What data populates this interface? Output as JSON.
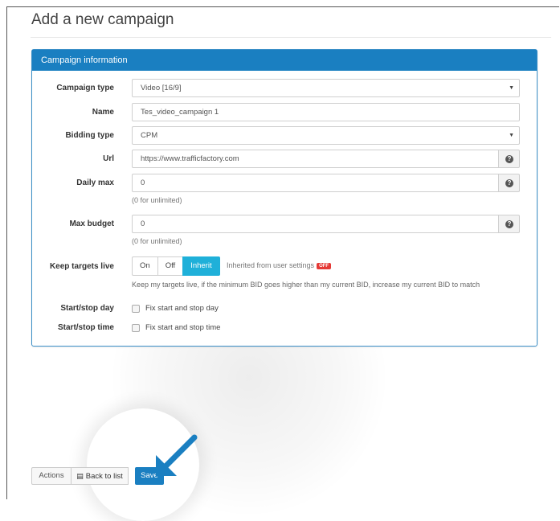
{
  "page": {
    "title": "Add a new campaign"
  },
  "panel": {
    "header": "Campaign information",
    "fields": {
      "campaign_type": {
        "label": "Campaign type",
        "value": "Video [16/9]"
      },
      "name": {
        "label": "Name",
        "value": "Tes_video_campaign 1"
      },
      "bidding_type": {
        "label": "Bidding type",
        "value": "CPM"
      },
      "url": {
        "label": "Url",
        "value": "https://www.trafficfactory.com"
      },
      "daily_max": {
        "label": "Daily max",
        "value": "0",
        "hint": "(0 for unlimited)"
      },
      "max_budget": {
        "label": "Max budget",
        "value": "0",
        "hint": "(0 for unlimited)"
      },
      "keep_targets_live": {
        "label": "Keep targets live",
        "options": [
          "On",
          "Off",
          "Inherit"
        ],
        "selected": "Inherit",
        "inherited_note": "Inherited from user settings",
        "badge": "OFF",
        "description": "Keep my targets live, if the minimum BID goes higher than my current BID, increase my current BID to match"
      },
      "start_stop_day": {
        "label": "Start/stop day",
        "checkbox_label": "Fix start and stop day"
      },
      "start_stop_time": {
        "label": "Start/stop time",
        "checkbox_label": "Fix start and stop time"
      }
    }
  },
  "footer": {
    "actions_label": "Actions",
    "back_label": "Back to list",
    "save_label": "Save"
  },
  "colors": {
    "accent": "#1a7fc1",
    "toggle_active": "#1fb0d9",
    "badge": "#e53935",
    "arrow": "#1a7fc1"
  }
}
